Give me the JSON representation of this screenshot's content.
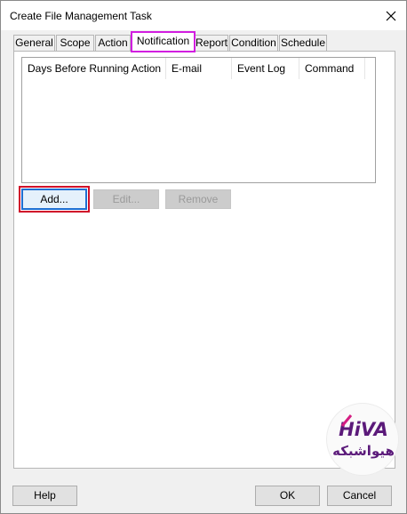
{
  "window": {
    "title": "Create File Management Task"
  },
  "tabs": [
    {
      "label": "General"
    },
    {
      "label": "Scope"
    },
    {
      "label": "Action"
    },
    {
      "label": "Notification",
      "active": true
    },
    {
      "label": "Report"
    },
    {
      "label": "Condition"
    },
    {
      "label": "Schedule"
    }
  ],
  "notification_list": {
    "columns": [
      "Days Before Running Action",
      "E-mail",
      "Event Log",
      "Command"
    ],
    "rows": []
  },
  "list_buttons": {
    "add": "Add...",
    "edit": "Edit...",
    "remove": "Remove"
  },
  "footer": {
    "help": "Help",
    "ok": "OK",
    "cancel": "Cancel"
  },
  "watermark": {
    "brand_en": "HiVA",
    "brand_fa": "هیواشبکه",
    "colors": {
      "purple": "#5b1a7a",
      "magenta": "#d41d82"
    }
  },
  "colors": {
    "active_tab_outline": "#d21ee0",
    "add_button_highlight": "#d0102a",
    "add_button_focus": "#1f6fd1"
  }
}
